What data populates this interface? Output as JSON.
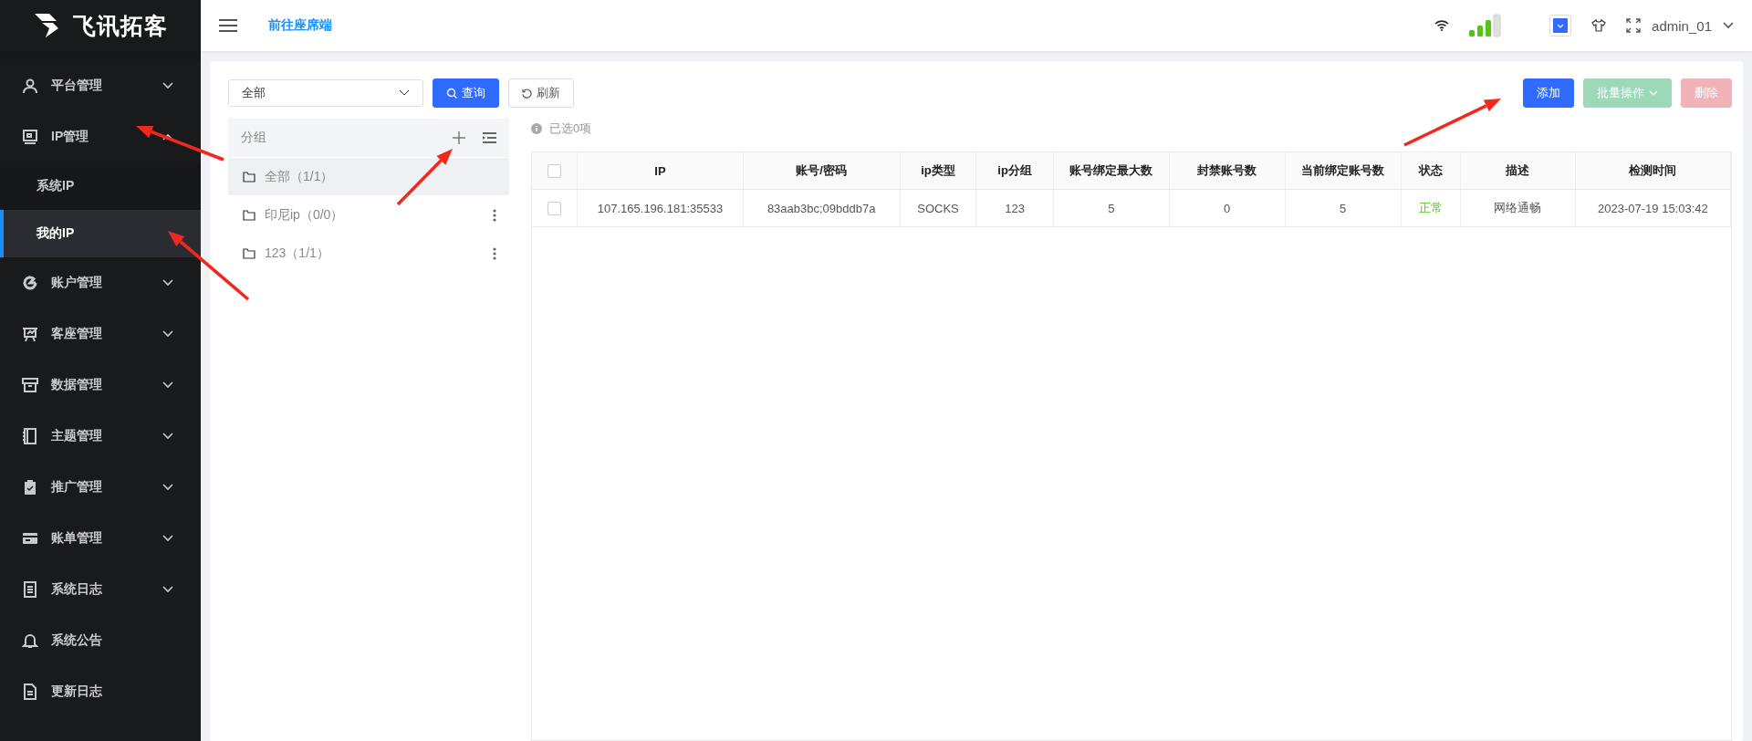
{
  "sidebar": {
    "logo_text": "飞讯拓客",
    "items": [
      {
        "kind": "group",
        "label": "平台管理",
        "expanded": false
      },
      {
        "kind": "group",
        "label": "IP管理",
        "expanded": true,
        "children": [
          {
            "label": "系统IP",
            "selected": false
          },
          {
            "label": "我的IP",
            "selected": true
          }
        ]
      },
      {
        "kind": "group",
        "label": "账户管理",
        "expanded": false
      },
      {
        "kind": "group",
        "label": "客座管理",
        "expanded": false
      },
      {
        "kind": "group",
        "label": "数据管理",
        "expanded": false
      },
      {
        "kind": "group",
        "label": "主题管理",
        "expanded": false
      },
      {
        "kind": "group",
        "label": "推广管理",
        "expanded": false
      },
      {
        "kind": "group",
        "label": "账单管理",
        "expanded": false
      },
      {
        "kind": "group",
        "label": "系统日志",
        "expanded": false
      },
      {
        "kind": "link",
        "label": "系统公告"
      },
      {
        "kind": "link",
        "label": "更新日志"
      }
    ]
  },
  "topbar": {
    "link": "前往座席端",
    "user": "admin_01"
  },
  "toolbar": {
    "select": {
      "value": "全部"
    },
    "left_buttons": [
      {
        "kind": "primary",
        "label": "查询",
        "disabled": false
      },
      {
        "kind": "default",
        "label": "刷新",
        "disabled": false
      }
    ],
    "right_buttons": [
      {
        "kind": "primary",
        "label": "添加",
        "disabled": false
      },
      {
        "kind": "success",
        "label": "批量操作",
        "disabled": true,
        "dropdown": true
      },
      {
        "kind": "danger",
        "label": "删除",
        "disabled": true
      }
    ]
  },
  "tree": {
    "title": "分组",
    "items": [
      {
        "label": "全部（1/1）",
        "selected": true,
        "has_menu": false
      },
      {
        "label": "印尼ip（0/0）",
        "selected": false,
        "has_menu": true
      },
      {
        "label": "123（1/1）",
        "selected": false,
        "has_menu": true
      }
    ]
  },
  "selection_info": "已选0项",
  "table": {
    "all_checked": false,
    "columns": [
      "IP",
      "账号/密码",
      "ip类型",
      "ip分组",
      "账号绑定最大数",
      "封禁账号数",
      "当前绑定账号数",
      "状态",
      "描述",
      "检测时间"
    ],
    "rows": [
      {
        "checked": false,
        "status_ok": true,
        "cells": [
          "107.165.196.181:35533",
          "83aab3bc;09bddb7a",
          "SOCKS",
          "123",
          "5",
          "0",
          "5",
          "正常",
          "网络通畅",
          "2023-07-19 15:03:42"
        ]
      }
    ]
  }
}
